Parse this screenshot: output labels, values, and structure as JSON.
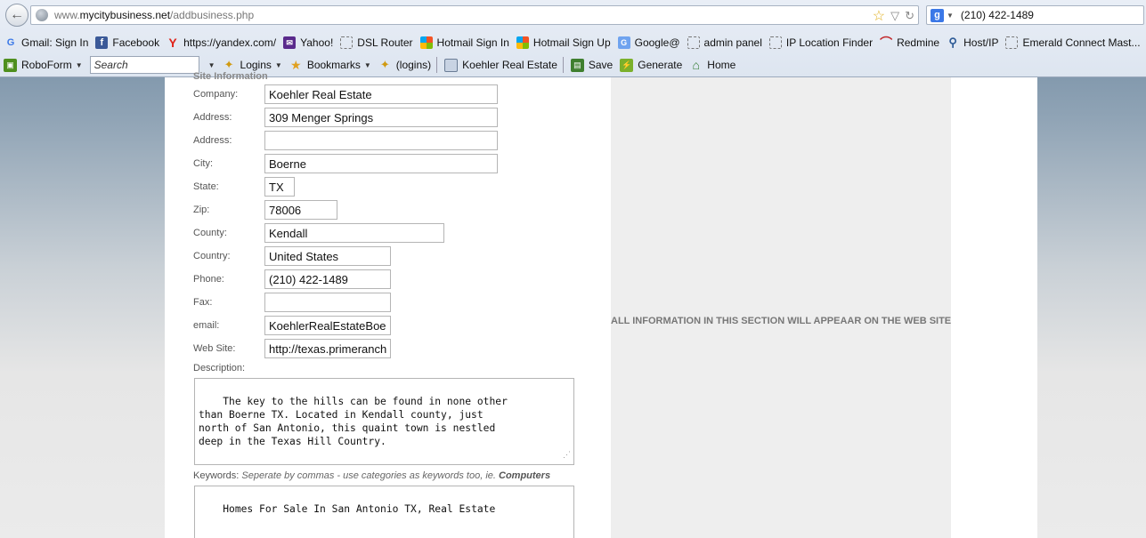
{
  "browser": {
    "url_prefix": "www.",
    "url_domain": "mycitybusiness.net",
    "url_path": "/addbusiness.php",
    "search_value": "(210) 422-1489",
    "search_engine_icon": "google-icon"
  },
  "bookmarks": [
    {
      "label": "Gmail: Sign In",
      "icon": "google-icon"
    },
    {
      "label": "Facebook",
      "icon": "facebook-icon"
    },
    {
      "label": "https://yandex.com/",
      "icon": "yandex-icon"
    },
    {
      "label": "Yahoo!",
      "icon": "mail-icon"
    },
    {
      "label": "DSL Router",
      "icon": "blank-page-icon"
    },
    {
      "label": "Hotmail Sign In",
      "icon": "microsoft-icon"
    },
    {
      "label": "Hotmail Sign Up",
      "icon": "microsoft-icon"
    },
    {
      "label": "Google@",
      "icon": "google-search-icon"
    },
    {
      "label": "admin panel",
      "icon": "blank-page-icon"
    },
    {
      "label": "IP Location Finder",
      "icon": "blank-page-icon"
    },
    {
      "label": "Redmine",
      "icon": "redmine-icon"
    },
    {
      "label": "Host/IP",
      "icon": "location-pin-icon"
    },
    {
      "label": "Emerald Connect Mast...",
      "icon": "blank-page-icon"
    }
  ],
  "roboform": {
    "label": "RoboForm",
    "search_placeholder": "Search",
    "logins": "Logins",
    "bookmarks": "Bookmarks",
    "logins_paren": "(logins)",
    "identity": "Koehler Real Estate",
    "save": "Save",
    "generate": "Generate",
    "home": "Home"
  },
  "form": {
    "section_title": "Site Information",
    "fields": {
      "company": {
        "label": "Company:",
        "value": "Koehler Real Estate"
      },
      "address1": {
        "label": "Address:",
        "value": "309 Menger Springs"
      },
      "address2": {
        "label": "Address:",
        "value": ""
      },
      "city": {
        "label": "City:",
        "value": "Boerne"
      },
      "state": {
        "label": "State:",
        "value": "TX"
      },
      "zip": {
        "label": "Zip:",
        "value": "78006"
      },
      "county": {
        "label": "County:",
        "value": "Kendall"
      },
      "country": {
        "label": "Country:",
        "value": "United States"
      },
      "phone": {
        "label": "Phone:",
        "value": "(210) 422-1489"
      },
      "fax": {
        "label": "Fax:",
        "value": ""
      },
      "email": {
        "label": "email:",
        "value": "KoehlerRealEstateBoe"
      },
      "website": {
        "label": "Web Site:",
        "value": "http://texas.primeranch"
      }
    },
    "description_label": "Description:",
    "description_value": "The key to the hills can be found in none other\nthan Boerne TX. Located in Kendall county, just\nnorth of San Antonio, this quaint town is nestled\ndeep in the Texas Hill Country.",
    "keywords_label": "Keywords:",
    "keywords_hint": "Seperate by commas - use categories as keywords too, ie.",
    "keywords_hint_bold": "Computers",
    "keywords_value": "Homes For Sale In San Antonio TX, Real Estate"
  },
  "side_panel": {
    "notice": "ALL INFORMATION IN THIS SECTION WILL APPEAAR ON THE WEB SITE"
  }
}
